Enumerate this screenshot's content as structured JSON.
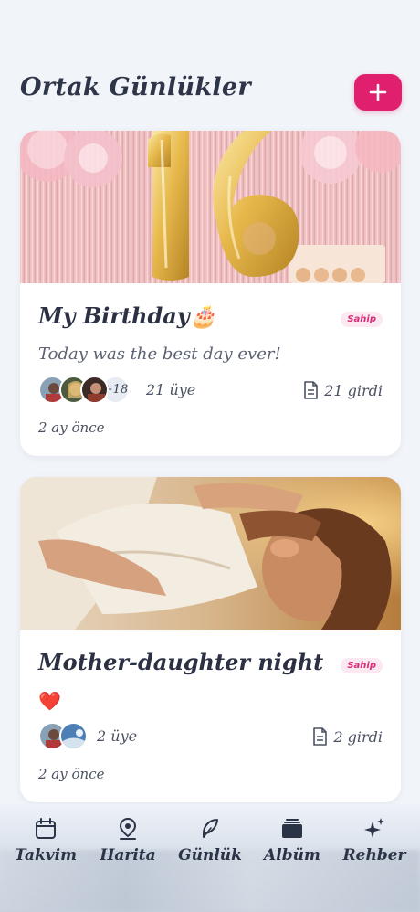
{
  "header": {
    "title": "Ortak Günlükler",
    "add_button_label": "+"
  },
  "journals": [
    {
      "title": "My Birthday🎂",
      "badge": "Sahip",
      "description": "Today was the best day ever!",
      "extra_members": "+18",
      "member_count": "21 üye",
      "entry_count": "21 girdi",
      "time_ago": "2 ay önce"
    },
    {
      "title": "Mother-daughter night",
      "badge": "Sahip",
      "description": "❤️",
      "member_count": "2 üye",
      "entry_count": "2 girdi",
      "time_ago": "2 ay önce"
    }
  ],
  "nav": {
    "items": [
      {
        "label": "Takvim",
        "icon": "calendar-icon"
      },
      {
        "label": "Harita",
        "icon": "map-pin-icon"
      },
      {
        "label": "Günlük",
        "icon": "feather-icon"
      },
      {
        "label": "Albüm",
        "icon": "album-icon"
      },
      {
        "label": "Rehber",
        "icon": "sparkle-icon"
      }
    ]
  },
  "colors": {
    "accent": "#e0206f",
    "background": "#f1f4f9",
    "text": "#2b3142",
    "badge_text": "#d6307a",
    "badge_bg": "#fbe8f0"
  }
}
